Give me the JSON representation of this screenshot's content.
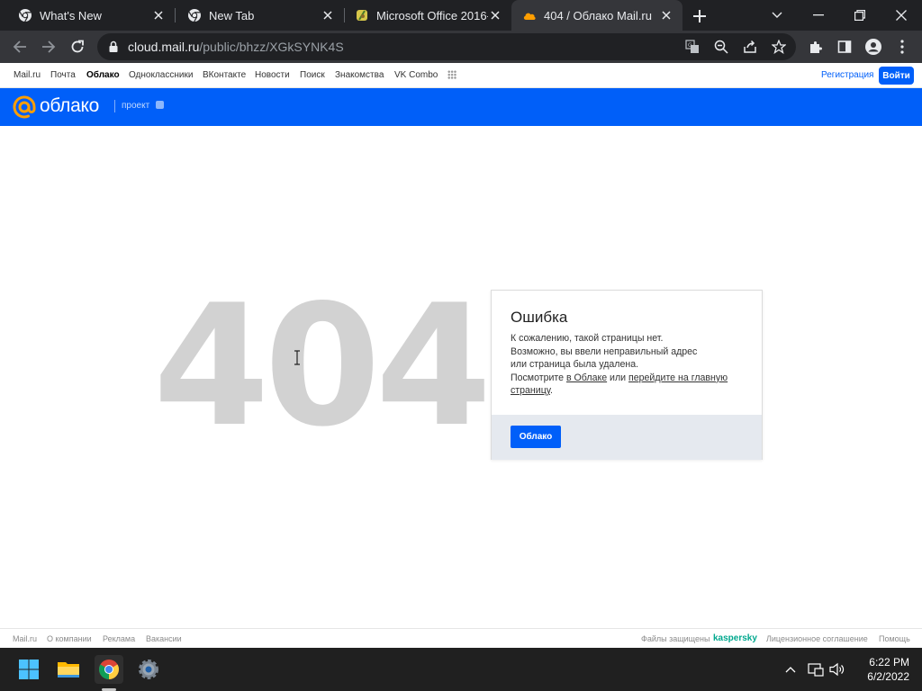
{
  "browser": {
    "tabs": [
      {
        "title": "What's New",
        "icon": "chrome-icon",
        "active": false
      },
      {
        "title": "New Tab",
        "icon": "chrome-icon",
        "active": false
      },
      {
        "title": "Microsoft Office 2016-...",
        "icon": "office-installer-icon",
        "active": false
      },
      {
        "title": "404 / Облако Mail.ru",
        "icon": "mailru-cloud-icon",
        "active": true
      }
    ],
    "url_host": "cloud.mail.ru",
    "url_path": "/public/bhzz/XGkSYNK4S"
  },
  "portal_nav": {
    "links": [
      "Mail.ru",
      "Почта",
      "Облако",
      "Одноклассники",
      "ВКонтакте",
      "Новости",
      "Поиск",
      "Знакомства",
      "VK Combo"
    ],
    "active_link": "Облако",
    "register": "Регистрация",
    "login": "Войти"
  },
  "cloud_header": {
    "logo_text": "облако",
    "project_label": "проект"
  },
  "error_page": {
    "code": "404",
    "title": "Ошибка",
    "line1": "К сожалению, такой страницы нет.",
    "line2": "Возможно, вы ввели неправильный адрес",
    "line3": "или страница была удалена.",
    "line4_prefix": "Посмотрите ",
    "link_cloud": "в Облаке",
    "line4_mid": " или ",
    "link_home": "перейдите на главную страницу",
    "line4_suffix": ".",
    "button": "Облако"
  },
  "page_footer": {
    "left_links": [
      "Mail.ru",
      "О компании",
      "Реклама",
      "Вакансии"
    ],
    "protected_text": "Файлы защищены",
    "kaspersky": "kaspersky",
    "right_links": [
      "Лицензионное соглашение",
      "Помощь"
    ]
  },
  "taskbar": {
    "time": "6:22 PM",
    "date": "6/2/2022"
  },
  "colors": {
    "brand_blue": "#005ff9",
    "brand_orange": "#ff9e00",
    "kaspersky_green": "#00a88e"
  }
}
